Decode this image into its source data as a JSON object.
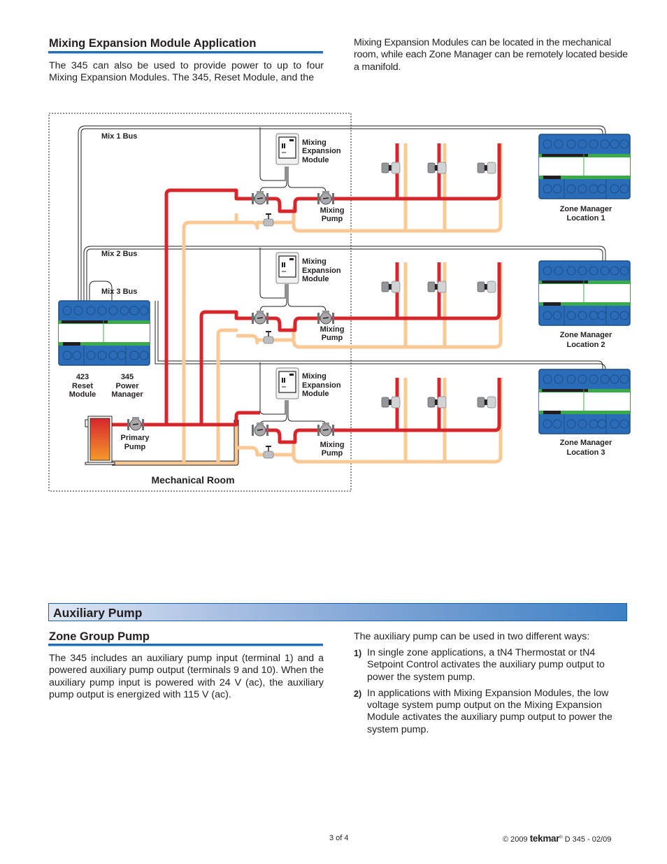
{
  "top_left": {
    "heading": "Mixing Expansion Module Application",
    "paragraph": "The 345 can also be used to provide power to up to four Mixing Expansion Modules. The 345, Reset Module, and the"
  },
  "top_right": {
    "paragraph": "Mixing Expansion Modules can be located in the mechanical room, while each Zone Manager can be remotely located beside a manifold."
  },
  "diagram": {
    "room_label": "Mechanical Room",
    "bus_labels": [
      "Mix 1 Bus",
      "Mix 2 Bus",
      "Mix 3 Bus"
    ],
    "mixing_expansion_module_label": [
      "Mixing",
      "Expansion",
      "Module"
    ],
    "mixing_pump_label": [
      "Mixing",
      "Pump"
    ],
    "primary_pump_label": [
      "Primary",
      "Pump"
    ],
    "reset_module_label": [
      "423",
      "Reset",
      "Module"
    ],
    "power_manager_label": [
      "345",
      "Power",
      "Manager"
    ],
    "zone_managers": [
      {
        "line1": "Zone Manager",
        "line2": "Location 1"
      },
      {
        "line1": "Zone Manager",
        "line2": "Location 2"
      },
      {
        "line1": "Zone Manager",
        "line2": "Location 3"
      }
    ],
    "colors": {
      "supply": "#d7262b",
      "return": "#f9c895",
      "controller_blue": "#2b6cb8",
      "controller_green": "#3aaa4a"
    }
  },
  "section": {
    "title": "Auxiliary Pump"
  },
  "zone_group": {
    "heading": "Zone Group Pump",
    "paragraph": "The 345 includes an auxiliary pump input (terminal 1) and a powered auxiliary pump output (terminals 9 and 10). When the auxiliary pump input is powered with 24 V (ac), the auxiliary pump output is energized with 115 V (ac)."
  },
  "aux_usage": {
    "intro": "The auxiliary pump can be used in two different ways:",
    "items": [
      {
        "num": "1)",
        "text": "In single zone applications, a tN4 Thermostat or tN4 Setpoint Control activates the auxiliary pump output to power the system pump."
      },
      {
        "num": "2)",
        "text": "In applications with Mixing Expansion Modules, the low voltage system pump output on the Mixing Expansion Module activates the auxiliary pump output to power the system pump."
      }
    ]
  },
  "footer": {
    "page": "3 of 4",
    "copyright": "© 2009",
    "brand": "tekmar",
    "brand_mark": "®",
    "doc_code": "D 345 - 02/09"
  }
}
